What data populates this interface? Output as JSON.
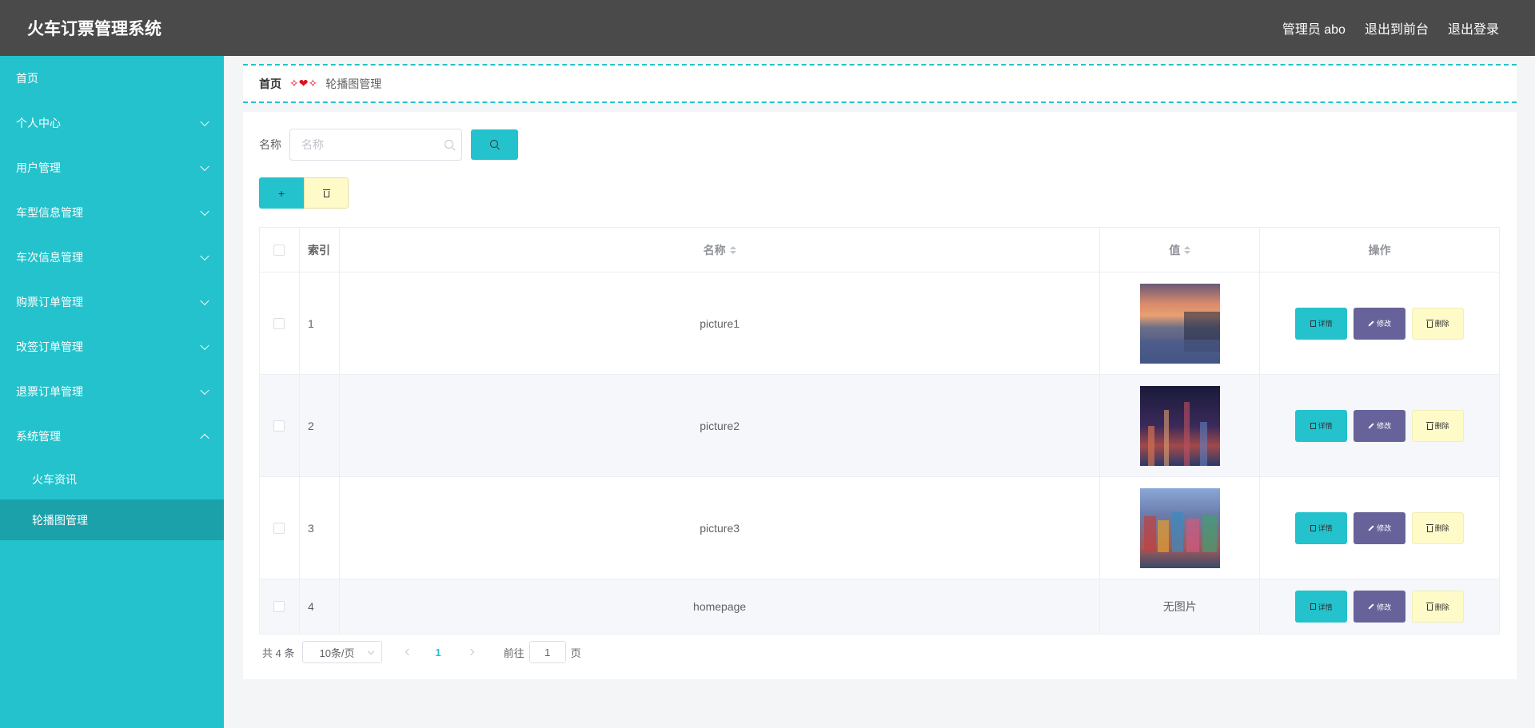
{
  "header": {
    "title": "火车订票管理系统",
    "user": "管理员 abo",
    "to_frontend": "退出到前台",
    "logout": "退出登录"
  },
  "sidebar": {
    "items": [
      {
        "label": "首页"
      },
      {
        "label": "个人中心"
      },
      {
        "label": "用户管理"
      },
      {
        "label": "车型信息管理"
      },
      {
        "label": "车次信息管理"
      },
      {
        "label": "购票订单管理"
      },
      {
        "label": "改签订单管理"
      },
      {
        "label": "退票订单管理"
      },
      {
        "label": "系统管理"
      }
    ],
    "subitems": [
      {
        "label": "火车资讯"
      },
      {
        "label": "轮播图管理"
      }
    ]
  },
  "breadcrumb": {
    "home": "首页",
    "separator": "✧❤✧",
    "current": "轮播图管理"
  },
  "search": {
    "label": "名称",
    "placeholder": "名称"
  },
  "actions": {
    "add": "+"
  },
  "table": {
    "columns": {
      "index": "索引",
      "name": "名称",
      "value": "值",
      "ops": "操作"
    },
    "op_labels": {
      "detail": "详情",
      "edit": "修改",
      "delete": "删除"
    },
    "rows": [
      {
        "index": "1",
        "name": "picture1",
        "value": "",
        "image": "sunset-coast"
      },
      {
        "index": "2",
        "name": "picture2",
        "value": "",
        "image": "night-city"
      },
      {
        "index": "3",
        "name": "picture3",
        "value": "",
        "image": "colorful-harbor"
      },
      {
        "index": "4",
        "name": "homepage",
        "value": "无图片",
        "image": ""
      }
    ]
  },
  "pagination": {
    "total": "共 4 条",
    "page_size": "10条/页",
    "current_page": "1",
    "goto_label": "前往",
    "goto_value": "1",
    "page_suffix": "页"
  },
  "colors": {
    "accent": "#23c2cc",
    "header_bg": "#4a4a4a",
    "edit_button": "#67639a",
    "delete_button": "#fffbc8"
  }
}
